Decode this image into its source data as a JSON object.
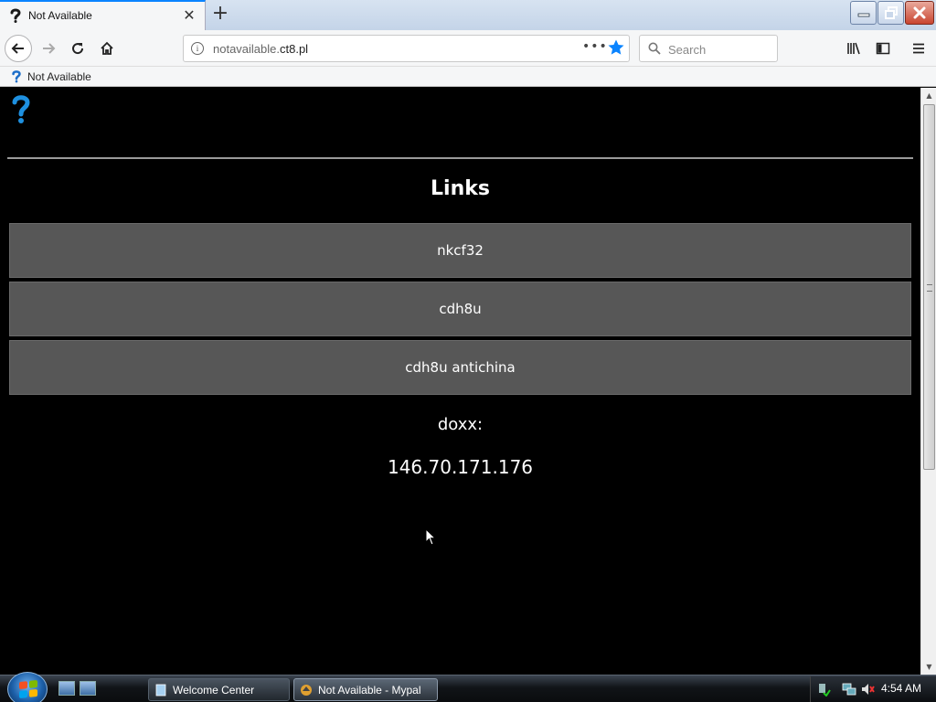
{
  "browser": {
    "tab": {
      "title": "Not Available",
      "close": "✕"
    },
    "newtab": "+",
    "url": {
      "prefix": "notavailable.",
      "domain": "ct8.pl"
    },
    "url_dots": "•••",
    "search_placeholder": "Search",
    "accent_color": "#0a84ff"
  },
  "bookmarks": [
    {
      "label": "Not Available"
    }
  ],
  "page": {
    "heading": "Links",
    "links": [
      {
        "label": "nkcf32"
      },
      {
        "label": "cdh8u"
      },
      {
        "label": "cdh8u antichina"
      }
    ],
    "doxx_label": "doxx:",
    "doxx_value": "146.70.171.176",
    "logo_color": "#1e90e0"
  },
  "taskbar": {
    "items": [
      {
        "label": "Welcome Center"
      },
      {
        "label": "Not Available - Mypal"
      }
    ],
    "clock": "4:54 AM"
  }
}
